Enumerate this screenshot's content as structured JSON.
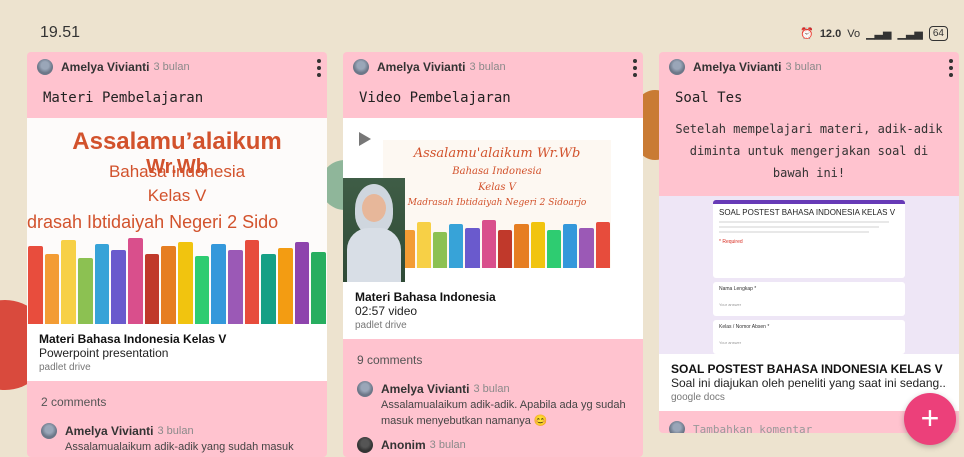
{
  "status": {
    "time": "19.51",
    "network_speed": "12.0",
    "battery": "64"
  },
  "posts": [
    {
      "author": "Amelya Vivianti",
      "time": "3 bulan",
      "title": "Materi Pembelajaran",
      "slide": {
        "line1": "Assalamu’alaikum",
        "line2": "Wr.Wb",
        "line3": "Bahasa Indonesia",
        "line4": "Kelas V",
        "line5": "adrasah Ibtidaiyah Negeri 2 Sido"
      },
      "attachment": {
        "title": "Materi Bahasa Indonesia Kelas V",
        "subtitle": "Powerpoint presentation",
        "source": "padlet drive"
      },
      "comments_count": "2 comments",
      "comments": [
        {
          "author": "Amelya Vivianti",
          "time": "3 bulan",
          "text": "Assalamualaikum adik-adik yang sudah masuk"
        }
      ]
    },
    {
      "author": "Amelya Vivianti",
      "time": "3 bulan",
      "title": "Video Pembelajaran",
      "video_slide": {
        "line1": "Assalamu'alaikum Wr.Wb",
        "line2": "Bahasa Indonesia",
        "line3": "Kelas V",
        "line4": "Madrasah Ibtidaiyah Negeri 2 Sidoarjo"
      },
      "attachment": {
        "title": "Materi Bahasa Indonesia",
        "subtitle": "02:57 video",
        "source": "padlet drive"
      },
      "comments_count": "9 comments",
      "comments": [
        {
          "author": "Amelya Vivianti",
          "time": "3 bulan",
          "text": "Assalamualaikum adik-adik. Apabila ada yg sudah masuk menyebutkan namanya 😊"
        },
        {
          "author": "Anonim",
          "time": "3 bulan",
          "text": ""
        }
      ]
    },
    {
      "author": "Amelya Vivianti",
      "time": "3 bulan",
      "title": "Soal Tes",
      "body": "Setelah mempelajari materi, adik-adik diminta untuk mengerjakan soal di bawah ini!",
      "form_preview": {
        "title": "SOAL POSTEST BAHASA INDONESIA KELAS V",
        "field1": "Nama Lengkap *",
        "field2": "Kelas / Nomor Absen *",
        "hint": "Your answer",
        "required": "* Required"
      },
      "attachment": {
        "title": "SOAL POSTEST BAHASA INDONESIA KELAS V",
        "subtitle": "Soal ini diajukan oleh peneliti yang saat ini sedang...",
        "source": "google docs"
      },
      "add_comment_placeholder": "Tambahkan komentar"
    }
  ],
  "fab_label": "+"
}
